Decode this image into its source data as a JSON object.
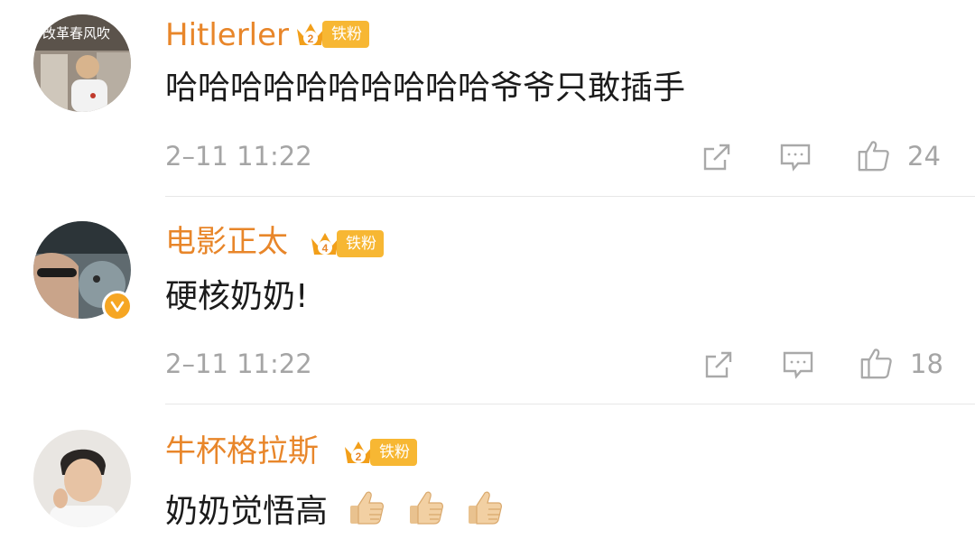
{
  "comments": [
    {
      "username": "Hitlerler",
      "avatar_caption": "改革春风吹",
      "badge_level": "2",
      "badge_label": "铁粉",
      "text": "哈哈哈哈哈哈哈哈哈哈爷爷只敢插手",
      "time": "2–11 11:22",
      "likes": "24",
      "verified": false
    },
    {
      "username": "电影正太",
      "badge_level": "4",
      "badge_label": "铁粉",
      "text": "硬核奶奶!",
      "time": "2–11 11:22",
      "likes": "18",
      "verified": true
    },
    {
      "username": "牛杯格拉斯",
      "badge_level": "2",
      "badge_label": "铁粉",
      "text": "奶奶觉悟高",
      "emoji": [
        "thumbs-up",
        "thumbs-up",
        "thumbs-up"
      ],
      "verified": false
    }
  ],
  "icons": {
    "share": "share-icon",
    "comment": "comment-icon",
    "like": "like-icon"
  },
  "colors": {
    "username": "#e8862a",
    "badge": "#f7b733",
    "muted": "#a5a5a5",
    "divider": "#e7e7e7"
  }
}
